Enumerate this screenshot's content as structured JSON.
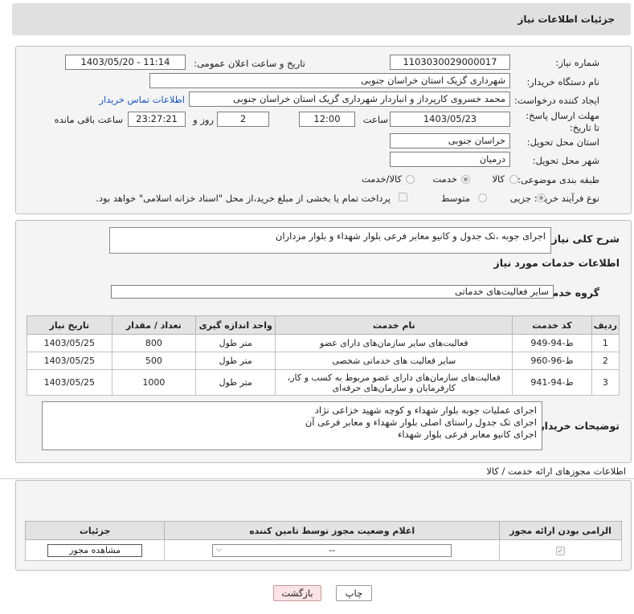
{
  "header": {
    "title": "جزئیات اطلاعات نیاز"
  },
  "info": {
    "need_number_label": "شماره نیاز:",
    "need_number": "1103030029000017",
    "announce_label": "تاریخ و ساعت اعلان عمومی:",
    "announce_value": "1403/05/20 - 11:14",
    "buyer_org_label": "نام دستگاه خریدار:",
    "buyer_org": "شهرداری گزیک استان خراسان جنوبی",
    "creator_label": "ایجاد کننده درخواست:",
    "creator": "محمد  خسروی کارپرداز و انباردار شهرداری گزیک استان خراسان جنوبی",
    "contact_link": "اطلاعات تماس خریدار",
    "deadline_label": "مهلت ارسال پاسخ: تا تاریخ:",
    "deadline_date": "1403/05/23",
    "time_label": "ساعت",
    "deadline_time": "12:00",
    "days": "2",
    "days_label": "روز و",
    "remaining": "23:27:21",
    "remaining_label": "ساعت باقی مانده",
    "province_label": "استان محل تحویل:",
    "province": "خراسان جنوبی",
    "city_label": "شهر محل تحویل:",
    "city": "درمیان",
    "category_label": "طبقه بندی موضوعی:",
    "category_options": [
      "کالا",
      "خدمت",
      "کالا/خدمت"
    ],
    "process_label": "نوع فرآیند خرید :",
    "process_options": [
      "جزیی",
      "متوسط"
    ],
    "payment_note": "پرداخت تمام یا بخشی از مبلغ خرید،از محل \"اسناد خزانه اسلامی\" خواهد بود."
  },
  "need": {
    "summary_label": "شرح کلی نیاز:",
    "summary": "اجرای جوبه ،تک جدول و کانیو معابر فرعی بلوار شهداء و بلوار مزداران",
    "services_title": "اطلاعات خدمات مورد نیاز",
    "group_label": "گروه خدمت:",
    "group": "سایر فعالیت‌های خدماتی"
  },
  "table": {
    "headers": [
      "ردیف",
      "کد خدمت",
      "نام خدمت",
      "واحد اندازه گیری",
      "تعداد / مقدار",
      "تاریخ نیاز"
    ],
    "rows": [
      [
        "1",
        "ط-94-949",
        "فعالیت‌های سایر سازمان‌های دارای عضو",
        "متر طول",
        "800",
        "1403/05/25"
      ],
      [
        "2",
        "ط-96-960",
        "سایر فعالیت های خدماتی شخصی",
        "متر طول",
        "500",
        "1403/05/25"
      ],
      [
        "3",
        "ط-94-941",
        "فعالیت‌های سازمان‌های دارای عضو مربوط به کسب و کار، کارفرمایان و سازمان‌های حرفه‌ای",
        "متر طول",
        "1000",
        "1403/05/25"
      ]
    ]
  },
  "buyer_notes": {
    "label": "توضیحات خریدار:",
    "lines": [
      "اجرای عملیات جوبه بلوار شهداء و کوچه شهید خزاعی نژاد",
      "اجرای تک جدول راستای اصلی بلوار شهداء و معابر فرعی آن",
      "اجرای کانیو معابر فرعی بلوار شهداء"
    ]
  },
  "permits": {
    "title": "اطلاعات مجوزهای ارائه خدمت / کالا",
    "headers": [
      "الزامی بودن ارائه مجوز",
      "اعلام وضعیت مجوز توسط تامین کننده",
      "جزئیات"
    ],
    "select_value": "--",
    "view_button": "مشاهده مجوز"
  },
  "footer": {
    "print": "چاپ",
    "back": "بازگشت"
  },
  "colors": {
    "back_bg": "#fbe3e3",
    "link": "#1a55c8",
    "header_bg": "#e0e0e0",
    "panel_bg": "#f4f4f4"
  }
}
